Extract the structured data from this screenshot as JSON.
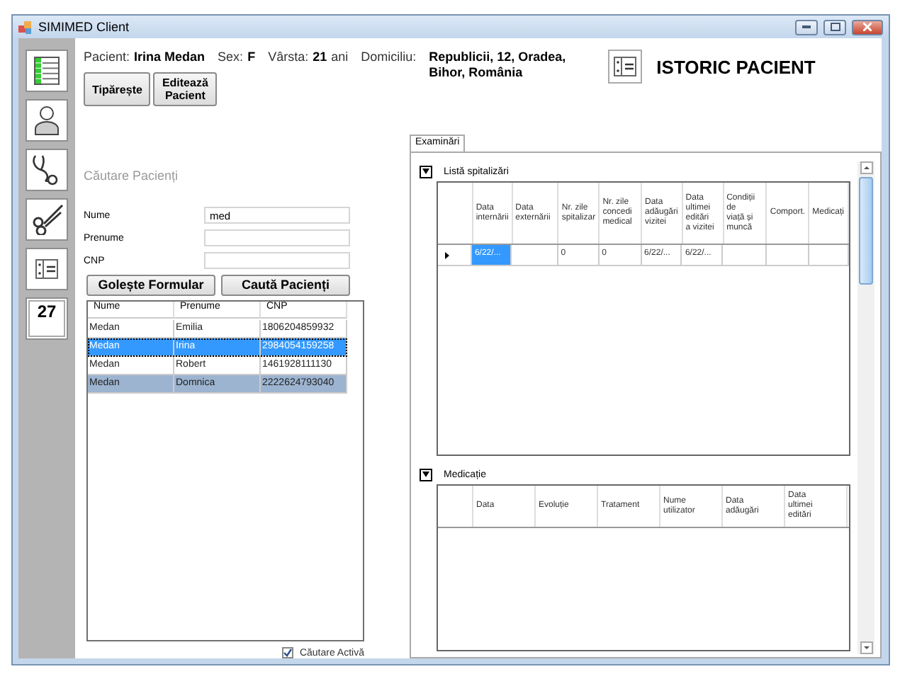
{
  "window": {
    "title": "SIMIMED Client"
  },
  "sidebar": {
    "calendar_day": "27"
  },
  "patient": {
    "fields": [
      {
        "label": "Pacient:",
        "value": "Irina Medan"
      },
      {
        "label": "Sex:",
        "value": "F"
      },
      {
        "label": "Vârsta:",
        "value": "21",
        "unit": "ani"
      },
      {
        "label": "Domiciliu:",
        "value_lines": [
          "Republicii, 12, Oradea,",
          "Bihor, România"
        ]
      }
    ],
    "buttons": [
      "Tipărește",
      "Editează\nPacient"
    ]
  },
  "page_title": "ISTORIC PACIENT",
  "search": {
    "title": "Căutare Pacienți",
    "fields": [
      {
        "label": "Nume",
        "value": "med"
      },
      {
        "label": "Prenume"
      },
      {
        "label": "CNP"
      }
    ],
    "buttons": [
      "Golește Formular",
      "Caută Pacienți"
    ],
    "columns": [
      "Nume",
      "Prenume",
      "CNP"
    ],
    "rows": [
      {
        "cells": [
          "Medan",
          "Emilia",
          "1806204859932"
        ],
        "selected": false,
        "focused": false
      },
      {
        "cells": [
          "Medan",
          "Irina",
          "2984054159258"
        ],
        "selected": true,
        "focused": true
      },
      {
        "cells": [
          "Medan",
          "Robert",
          "1461928111130"
        ],
        "selected": false,
        "focused": false
      },
      {
        "cells": [
          "Medan",
          "Domnica",
          "2222624793040"
        ],
        "selected": true,
        "focused": false
      }
    ],
    "active_search": {
      "label": "Căutare Activă",
      "checked": true
    }
  },
  "tabs": [
    {
      "label": "Examinări",
      "selected": true
    }
  ],
  "sections": [
    {
      "title": "Listă spitalizări",
      "expanded": true,
      "columns": [
        "Data\ninternării",
        "Data\nexternării",
        "Nr. zile\nspitalizar",
        "Nr. zile\nconcedi\nmedical",
        "Data\nadăugări\nvizitei",
        "Data\nultimei\neditări\na vizitei",
        "Condiții\nde\nviață și\nmuncă",
        "Comport.",
        "Medicați"
      ],
      "rows": [
        {
          "current": true,
          "cells": [
            {
              "text": "6/22/...",
              "selected": true
            },
            {
              "text": "",
              "selected": false
            },
            {
              "text": "0",
              "selected": false
            },
            {
              "text": "0",
              "selected": false
            },
            {
              "text": "6/22/...",
              "selected": false
            },
            {
              "text": "6/22/...",
              "selected": false
            },
            {
              "text": "",
              "selected": false
            },
            {
              "text": "",
              "selected": false
            },
            {
              "text": "",
              "selected": false
            }
          ]
        }
      ]
    },
    {
      "title": "Medicație",
      "expanded": true,
      "columns": [
        "Data",
        "Evoluție",
        "Tratament",
        "Nume\nutilizator",
        "Data\nadăugări",
        "Data\nultimei\neditări"
      ]
    }
  ]
}
